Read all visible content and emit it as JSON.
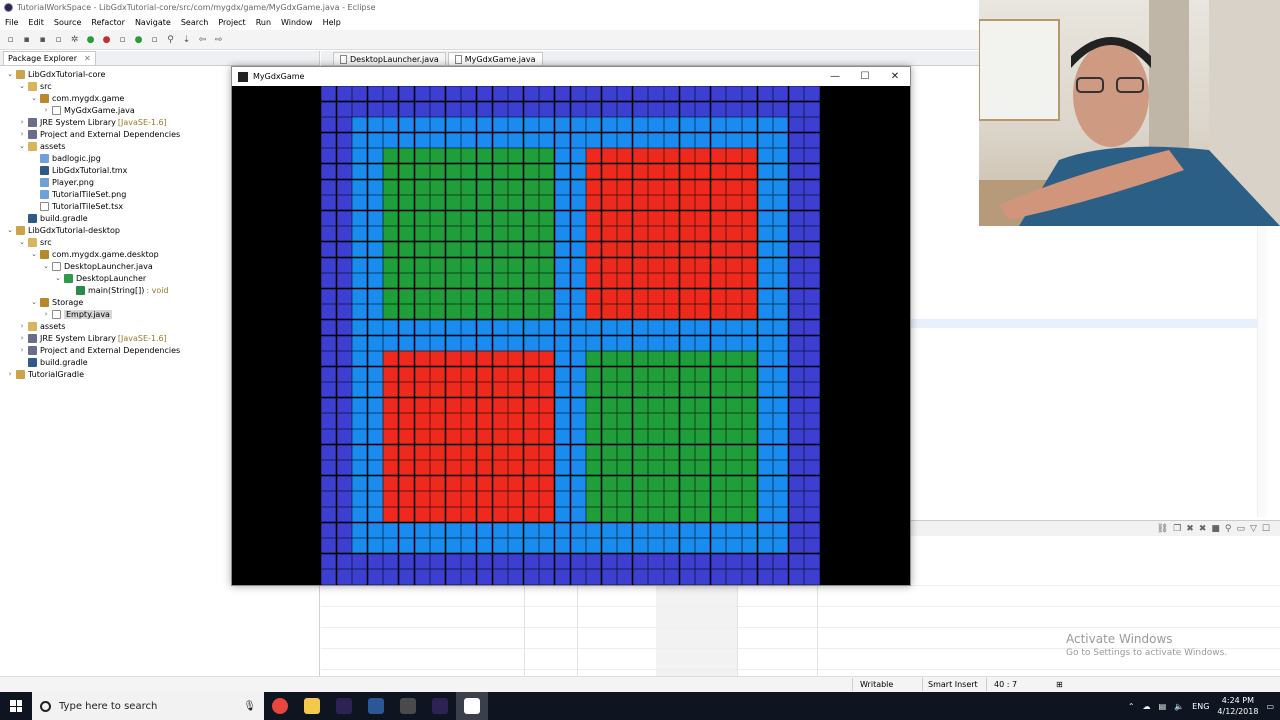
{
  "eclipse": {
    "title": "TutorialWorkSpace - LibGdxTutorial-core/src/com/mygdx/game/MyGdxGame.java - Eclipse",
    "menu": [
      "File",
      "Edit",
      "Source",
      "Refactor",
      "Navigate",
      "Search",
      "Project",
      "Run",
      "Window",
      "Help"
    ]
  },
  "package_explorer": {
    "tab_label": "Package Explorer",
    "items": [
      {
        "label": "LibGdxTutorial-core",
        "depth": 0,
        "twisty": "open",
        "icon": "project"
      },
      {
        "label": "src",
        "depth": 1,
        "twisty": "open",
        "icon": "folder"
      },
      {
        "label": "com.mygdx.game",
        "depth": 2,
        "twisty": "open",
        "icon": "package"
      },
      {
        "label": "MyGdxGame.java",
        "depth": 3,
        "twisty": "closed",
        "icon": "java"
      },
      {
        "label": "JRE System Library",
        "suffix": "[JavaSE-1.6]",
        "depth": 1,
        "twisty": "closed",
        "icon": "lib"
      },
      {
        "label": "Project and External Dependencies",
        "depth": 1,
        "twisty": "closed",
        "icon": "lib"
      },
      {
        "label": "assets",
        "depth": 1,
        "twisty": "open",
        "icon": "folder"
      },
      {
        "label": "badlogic.jpg",
        "depth": 2,
        "twisty": "none",
        "icon": "file"
      },
      {
        "label": "LibGdxTutorial.tmx",
        "depth": 2,
        "twisty": "none",
        "icon": "gradle"
      },
      {
        "label": "Player.png",
        "depth": 2,
        "twisty": "none",
        "icon": "file"
      },
      {
        "label": "TutorialTileSet.png",
        "depth": 2,
        "twisty": "none",
        "icon": "file"
      },
      {
        "label": "TutorialTileSet.tsx",
        "depth": 2,
        "twisty": "none",
        "icon": "java"
      },
      {
        "label": "build.gradle",
        "depth": 1,
        "twisty": "none",
        "icon": "gradle"
      },
      {
        "label": "LibGdxTutorial-desktop",
        "depth": 0,
        "twisty": "open",
        "icon": "project"
      },
      {
        "label": "src",
        "depth": 1,
        "twisty": "open",
        "icon": "folder"
      },
      {
        "label": "com.mygdx.game.desktop",
        "depth": 2,
        "twisty": "open",
        "icon": "package"
      },
      {
        "label": "DesktopLauncher.java",
        "depth": 3,
        "twisty": "open",
        "icon": "java"
      },
      {
        "label": "DesktopLauncher",
        "depth": 4,
        "twisty": "open",
        "icon": "class"
      },
      {
        "label": "main(String[])",
        "suffix": ": void",
        "depth": 5,
        "twisty": "none",
        "icon": "method"
      },
      {
        "label": "Storage",
        "depth": 2,
        "twisty": "open",
        "icon": "package"
      },
      {
        "label": "Empty.java",
        "depth": 3,
        "twisty": "closed",
        "icon": "java",
        "selected": true
      },
      {
        "label": "assets",
        "depth": 1,
        "twisty": "closed",
        "icon": "folder"
      },
      {
        "label": "JRE System Library",
        "suffix": "[JavaSE-1.6]",
        "depth": 1,
        "twisty": "closed",
        "icon": "lib"
      },
      {
        "label": "Project and External Dependencies",
        "depth": 1,
        "twisty": "closed",
        "icon": "lib"
      },
      {
        "label": "build.gradle",
        "depth": 1,
        "twisty": "none",
        "icon": "gradle"
      },
      {
        "label": "TutorialGradle",
        "depth": 0,
        "twisty": "closed",
        "icon": "project"
      }
    ]
  },
  "editor": {
    "tabs": [
      {
        "label": "DesktopLauncher.java",
        "active": false
      },
      {
        "label": "MyGdxGame.java",
        "active": true
      }
    ]
  },
  "statusbar": {
    "writable": "Writable",
    "insert_mode": "Smart Insert",
    "position": "40 : 7"
  },
  "watermark": {
    "title": "Activate Windows",
    "subtitle": "Go to Settings to activate Windows."
  },
  "game_window": {
    "title": "MyGdxGame",
    "minimize": "—",
    "maximize": "☐",
    "close": "✕",
    "tilemap": {
      "cols": 32,
      "rows": 32,
      "colors": {
        "border": "#3c3fd0",
        "path": "#1a8cf0",
        "green": "#1f9e3a",
        "red": "#ee2a1e"
      },
      "quadrants": [
        {
          "color": "green",
          "rows": [
            4,
            14
          ],
          "cols": [
            4,
            14
          ]
        },
        {
          "color": "red",
          "rows": [
            4,
            14
          ],
          "cols": [
            17,
            27
          ]
        },
        {
          "color": "red",
          "rows": [
            17,
            27
          ],
          "cols": [
            4,
            14
          ]
        },
        {
          "color": "green",
          "rows": [
            17,
            27
          ],
          "cols": [
            17,
            27
          ]
        }
      ]
    }
  },
  "taskbar": {
    "search_placeholder": "Type here to search",
    "apps": [
      {
        "name": "chrome",
        "color": "#e8453c",
        "active": false
      },
      {
        "name": "file-explorer",
        "color": "#f2c94c",
        "active": false
      },
      {
        "name": "eclipse",
        "color": "#2c2255",
        "active": false
      },
      {
        "name": "word",
        "color": "#2b5797",
        "active": false
      },
      {
        "name": "obs",
        "color": "#4a4a4a",
        "active": false
      },
      {
        "name": "eclipse",
        "color": "#2c2255",
        "active": false
      },
      {
        "name": "libgdx-game",
        "color": "#ffffff",
        "active": true
      }
    ],
    "language": "ENG",
    "time": "4:24 PM",
    "date": "4/12/2018"
  }
}
